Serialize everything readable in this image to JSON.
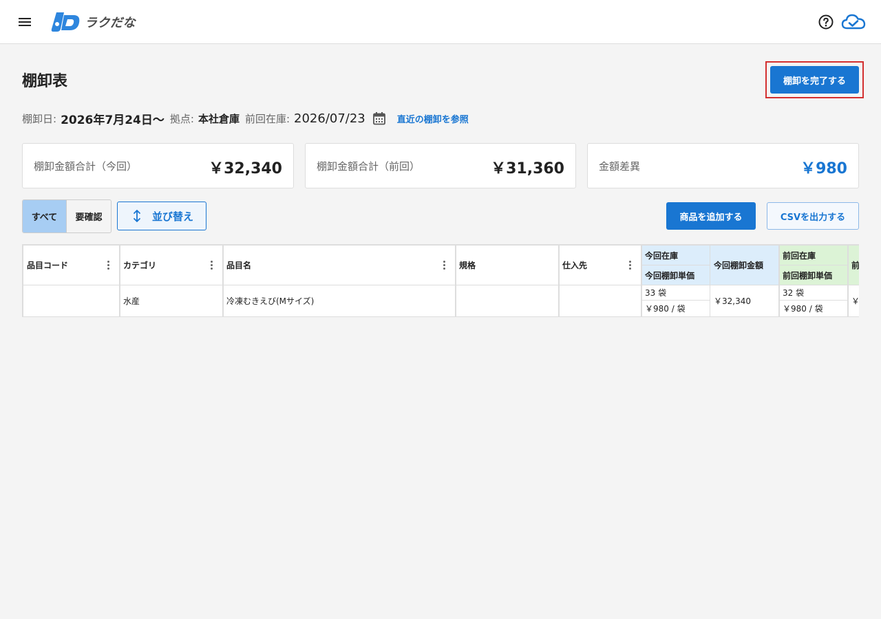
{
  "header": {
    "app_name": "ラクだな",
    "menu_icon": "hamburger-menu-icon",
    "help_icon": "help-circle-icon",
    "cloud_icon": "cloud-check-icon",
    "brand_color": "#1976d2"
  },
  "page": {
    "title": "棚卸表",
    "complete_button": "棚卸を完了する"
  },
  "meta": {
    "date_label": "棚卸日:",
    "date_value": "2026年7月24日〜",
    "location_label": "拠点:",
    "location_value": "本社倉庫",
    "prev_stock_label": "前回在庫:",
    "prev_stock_value": "2026/07/23",
    "calendar_icon": "calendar-icon",
    "reference_link": "直近の棚卸を参照"
  },
  "summary": {
    "current_label": "棚卸金額合計（今回）",
    "current_value": "￥32,340",
    "previous_label": "棚卸金額合計（前回）",
    "previous_value": "￥31,360",
    "diff_label": "金額差異",
    "diff_value": "￥980",
    "diff_color": "#1976d2"
  },
  "toolbar": {
    "filter_all": "すべて",
    "filter_check": "要確認",
    "sort_label": "並び替え",
    "sort_icon": "vertical-arrows-icon",
    "add_product": "商品を追加する",
    "export_csv": "CSVを出力する"
  },
  "table": {
    "headers": {
      "code": "品目コード",
      "category": "カテゴリ",
      "name": "品目名",
      "spec": "規格",
      "supplier": "仕入先",
      "cur_stock": "今回在庫",
      "cur_unit_price": "今回棚卸単価",
      "cur_amount": "今回棚卸金額",
      "prev_stock": "前回在庫",
      "prev_unit_price": "前回棚卸単価",
      "prev_amount_truncated": "前"
    },
    "rows": [
      {
        "code": "",
        "category": "水産",
        "name": "冷凍むきえび(Mサイズ)",
        "spec": "",
        "supplier": "",
        "cur_stock": "33 袋",
        "cur_unit_price": "￥980 / 袋",
        "cur_amount": "￥32,340",
        "prev_stock": "32 袋",
        "prev_unit_price": "￥980 / 袋",
        "prev_amount_truncated": "￥"
      }
    ]
  }
}
